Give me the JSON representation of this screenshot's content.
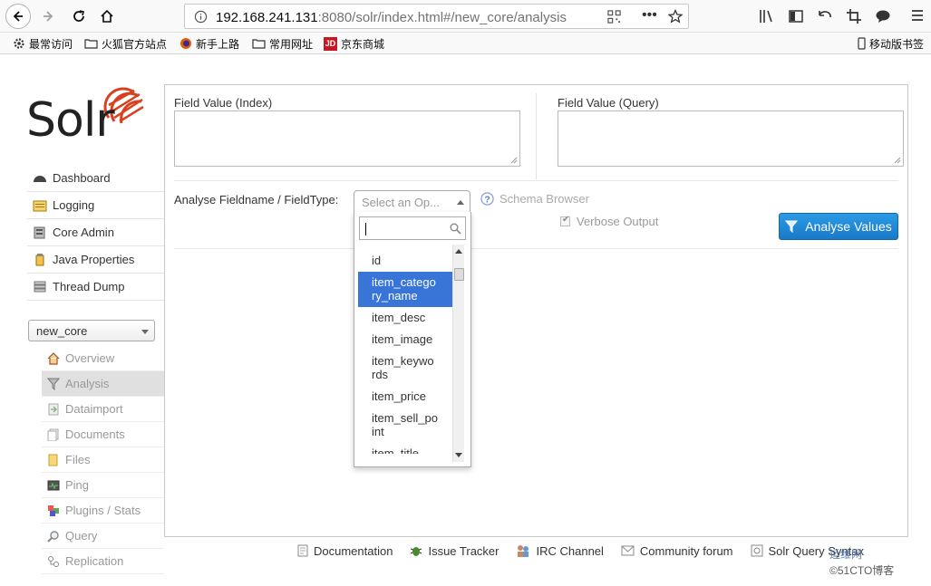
{
  "browser": {
    "url_prefix": "192.168.241.131",
    "url_rest": ":8080/solr/index.html#/new_core/analysis",
    "bookmarks": [
      "最常访问",
      "火狐官方站点",
      "新手上路",
      "常用网址",
      "京东商城"
    ],
    "mobile_bookmarks": "移动版书签"
  },
  "solr": {
    "logo": "Solr",
    "menu": [
      {
        "label": "Dashboard",
        "icon": "dashboard-icon"
      },
      {
        "label": "Logging",
        "icon": "logging-icon"
      },
      {
        "label": "Core Admin",
        "icon": "core-admin-icon"
      },
      {
        "label": "Java Properties",
        "icon": "java-properties-icon"
      },
      {
        "label": "Thread Dump",
        "icon": "thread-dump-icon"
      }
    ],
    "core_selector": "new_core",
    "core_menu": [
      {
        "label": "Overview",
        "icon": "overview-icon"
      },
      {
        "label": "Analysis",
        "icon": "analysis-icon"
      },
      {
        "label": "Dataimport",
        "icon": "dataimport-icon"
      },
      {
        "label": "Documents",
        "icon": "documents-icon"
      },
      {
        "label": "Files",
        "icon": "files-icon"
      },
      {
        "label": "Ping",
        "icon": "ping-icon"
      },
      {
        "label": "Plugins / Stats",
        "icon": "plugins-icon"
      },
      {
        "label": "Query",
        "icon": "query-icon"
      },
      {
        "label": "Replication",
        "icon": "replication-icon"
      }
    ]
  },
  "analysis": {
    "field_value_index_label": "Field Value (Index)",
    "field_value_query_label": "Field Value (Query)",
    "fieldname_label": "Analyse Fieldname / FieldType:",
    "select_placeholder": "Select an Op...",
    "options": [
      "id",
      "item_catego ry_name",
      "item_desc",
      "item_image",
      "item_keywo rds",
      "item_price",
      "item_sell_po int",
      "item_title"
    ],
    "highlighted_option": "item_catego ry_name",
    "schema_browser": "Schema Browser",
    "verbose_output": "Verbose Output",
    "analyse_button": "Analyse Values"
  },
  "footer": {
    "links": [
      "Documentation",
      "Issue Tracker",
      "IRC Channel",
      "Community forum",
      "Solr Query Syntax"
    ]
  },
  "watermark": {
    "line1": "运维网",
    "line2": "©51CTO博客"
  }
}
